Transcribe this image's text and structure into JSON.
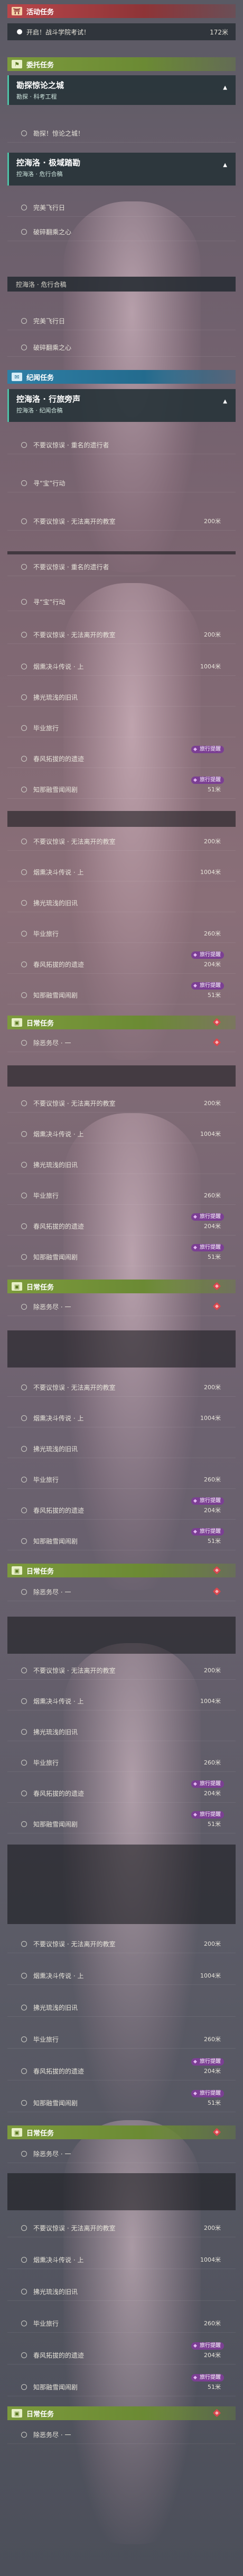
{
  "header": {
    "activity": "活动任务",
    "event": "委托任务",
    "journey": "纪闻任务",
    "daily": "日常任务"
  },
  "activity_item": {
    "label": "开启！战斗学院考试！",
    "distance": "172米"
  },
  "quest1": {
    "title": "勘探惊论之城",
    "subtitle": "勘探 · 科考工程",
    "step": "勘探！惊论之城！"
  },
  "quest2": {
    "title": "控海洛 · 极域踏勘",
    "subtitle": "控海洛 · 危行合稿",
    "steps": [
      "完美飞行日",
      "破碎翻乘之心"
    ]
  },
  "quest3_header": "控海洛 · 危行合稿",
  "quest3": {
    "title": "控海洛 · 行旅旁声",
    "subtitle": "控海洛 · 纪闻合稿"
  },
  "journey_items": [
    {
      "label": "不要议惊误 · 重名的遗行者",
      "distance": ""
    },
    {
      "label": "寻“宝”行动",
      "distance": ""
    },
    {
      "label": "不要议惊误 · 无法离开的教室",
      "distance": "200米"
    }
  ],
  "list_items": [
    {
      "label": "不要议惊误 · 无法离开的教室",
      "distance": "200米"
    },
    {
      "label": "烟熏决斗传说 · 上",
      "distance": "1004米"
    },
    {
      "label": "拂光琉浅的旧讯",
      "distance": ""
    },
    {
      "label": "毕业旅行",
      "distance": "260米"
    },
    {
      "label": "春风拓拔的的遗迹",
      "distance": "204米"
    },
    {
      "label": "知那融雪闻闹剧",
      "distance": "51米"
    }
  ],
  "badge_label": "旅行提醒",
  "daily_item": "除恶务尽 · 一",
  "colors": {
    "red": "#b8464a",
    "green": "#7c9a3c",
    "blue": "#2f7fa5",
    "teal": "#4fc1a7"
  }
}
